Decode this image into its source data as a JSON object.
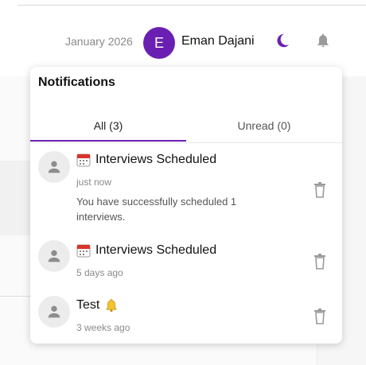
{
  "header": {
    "date": "January 2026",
    "avatar_letter": "E",
    "user_name": "Eman Dajani",
    "accent_color": "#6a1fb3"
  },
  "notifications_panel": {
    "title": "Notifications",
    "tabs": [
      {
        "label": "All (3)",
        "active": true
      },
      {
        "label": "Unread (0)",
        "active": false
      }
    ],
    "items": [
      {
        "title": "Interviews Scheduled",
        "icon": "calendar-icon",
        "time": "just now",
        "body": "You have successfully scheduled 1 interviews."
      },
      {
        "title": "Interviews Scheduled",
        "icon": "calendar-icon",
        "time": "5 days ago",
        "body": ""
      },
      {
        "title": "Test",
        "icon": "bell-emoji-icon",
        "time": "3 weeks ago",
        "body": ""
      }
    ]
  }
}
